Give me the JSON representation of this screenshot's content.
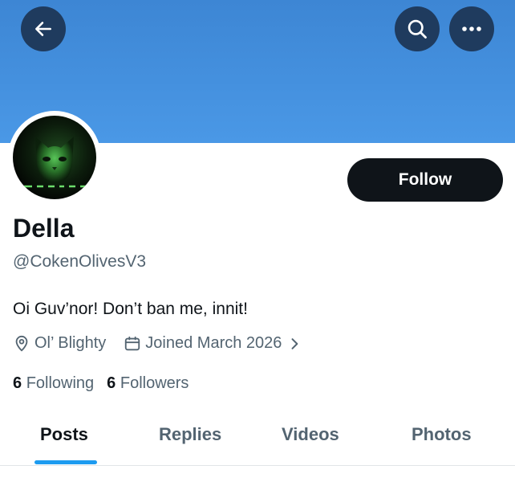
{
  "header": {
    "icons": [
      "back-arrow-icon",
      "search-icon",
      "more-icon"
    ]
  },
  "profile": {
    "display_name": "Della",
    "handle": "@CokenOlivesV3",
    "bio": "Oi Guv’nor! Don’t ban me, innit!",
    "location": "Ol’ Blighty",
    "joined": "Joined March 2026",
    "follow_label": "Follow"
  },
  "stats": {
    "following_count": "6",
    "following_label": "Following",
    "followers_count": "6",
    "followers_label": "Followers"
  },
  "tabs": {
    "items": [
      {
        "label": "Posts",
        "active": true
      },
      {
        "label": "Replies",
        "active": false
      },
      {
        "label": "Videos",
        "active": false
      },
      {
        "label": "Photos",
        "active": false
      }
    ]
  },
  "colors": {
    "banner": "#4a98e6",
    "button_dark": "#0f1419",
    "accent": "#1d9bf0",
    "muted_text": "#536471"
  }
}
